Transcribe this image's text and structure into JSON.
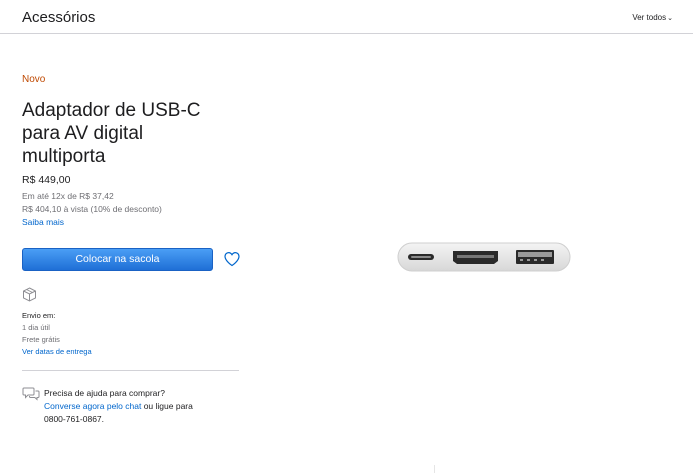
{
  "header": {
    "title": "Acessórios",
    "see_all": "Ver todos",
    "chevron": "⌄"
  },
  "product": {
    "badge": "Novo",
    "title_lines": [
      "Adaptador de USB-C",
      "para AV digital",
      "multiporta"
    ],
    "price": "R$ 449,00",
    "installments": "Em até 12x de R$ 37,42",
    "cash_price": "R$ 404,10 à vista (10% de desconto)",
    "learn_more": "Saiba mais",
    "add_to_bag": "Colocar na sacola",
    "image_icon": "usb-c-multiport-adapter-image"
  },
  "shipping": {
    "icon": "box-icon",
    "label": "Envio em:",
    "duration": "1 dia útil",
    "cost": "Frete grátis",
    "dates_link": "Ver datas de entrega"
  },
  "help": {
    "icon": "chat-bubbles-icon",
    "question": "Precisa de ajuda para comprar?",
    "chat_link": "Converse agora pelo chat",
    "or_call": " ou ligue para",
    "phone": "0800-761-0867."
  },
  "colors": {
    "accent_orange": "#bf4800",
    "link_blue": "#0066cc",
    "button_blue": "#1f6fd6"
  }
}
